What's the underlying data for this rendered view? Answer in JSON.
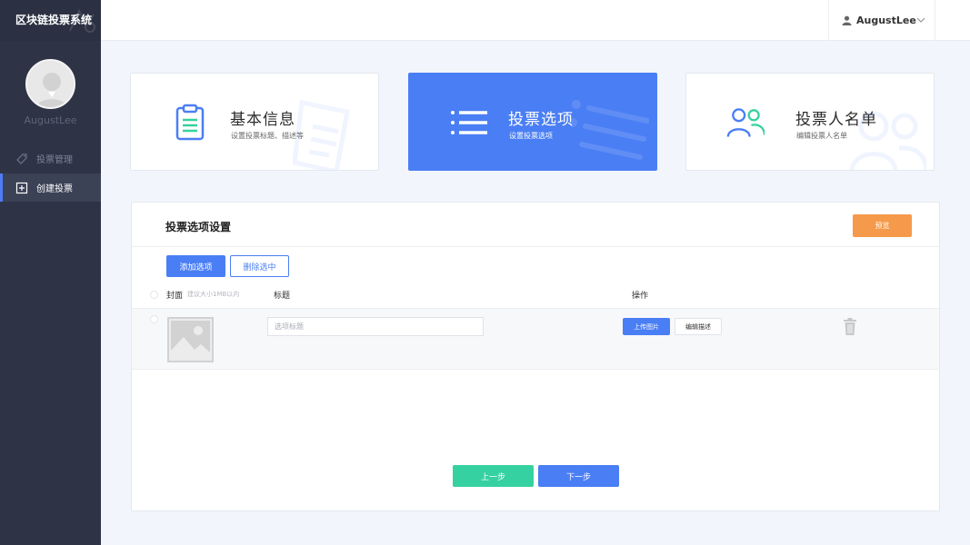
{
  "app": {
    "title": "区块链投票系统"
  },
  "user": {
    "name": "AugustLee",
    "avatar_caption": "AugustLee"
  },
  "sidebar": {
    "items": [
      {
        "label": "投票管理",
        "icon": "tag-icon",
        "active": false
      },
      {
        "label": "创建投票",
        "icon": "plus-square-icon",
        "active": true
      }
    ]
  },
  "steps": [
    {
      "title": "基本信息",
      "subtitle": "设置投票标题、描述等",
      "icon": "clipboard-icon",
      "active": false
    },
    {
      "title": "投票选项",
      "subtitle": "设置投票选项",
      "icon": "list-icon",
      "active": true
    },
    {
      "title": "投票人名单",
      "subtitle": "编辑投票人名单",
      "icon": "users-icon",
      "active": false
    }
  ],
  "panel": {
    "title": "投票选项设置",
    "preview_label": "预览",
    "add_label": "添加选项",
    "delete_label": "删除选中",
    "columns": {
      "cover": "封面",
      "cover_hint": "建议大小1MB以内",
      "title": "标题",
      "operations": "操作"
    },
    "rows": [
      {
        "title_placeholder": "选项标题",
        "upload_label": "上传图片",
        "edit_desc_label": "编辑描述"
      }
    ],
    "prev_label": "上一步",
    "next_label": "下一步"
  },
  "colors": {
    "sidebar_bg": "#2e3446",
    "accent": "#4a7ef4",
    "preview": "#f59a4a",
    "prev_button": "#36d1a0",
    "icon_green": "#36d1a0"
  }
}
